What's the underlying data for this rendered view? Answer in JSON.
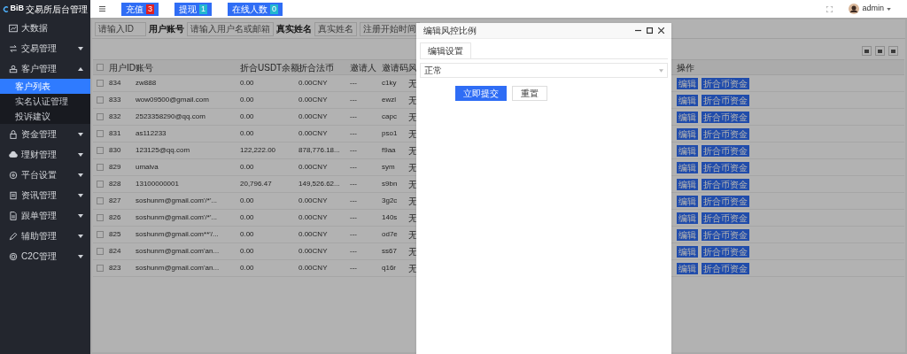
{
  "logo": {
    "text": "BiB",
    "subtitle": "交易所后台管理"
  },
  "sidebar": {
    "items": [
      {
        "label": "大数据"
      },
      {
        "label": "交易管理",
        "expanded": false
      },
      {
        "label": "客户管理",
        "expanded": true,
        "children": [
          {
            "label": "客户列表",
            "selected": true
          },
          {
            "label": "实名认证管理",
            "selected": false
          },
          {
            "label": "投诉建议",
            "selected": false
          }
        ]
      },
      {
        "label": "资金管理",
        "expanded": false
      },
      {
        "label": "理财管理",
        "expanded": false
      },
      {
        "label": "平台设置",
        "expanded": false
      },
      {
        "label": "资讯管理",
        "expanded": false
      },
      {
        "label": "跟单管理",
        "expanded": false
      },
      {
        "label": "辅助管理",
        "expanded": false
      },
      {
        "label": "C2C管理",
        "expanded": false
      }
    ]
  },
  "top_bar": {
    "badges": [
      {
        "label": "充值",
        "count": "3",
        "color": "#e02020"
      },
      {
        "label": "提现",
        "count": "1",
        "color": "#22b8cf"
      },
      {
        "label": "在线人数",
        "count": "0",
        "color": "#22b8cf"
      }
    ],
    "user": "admin"
  },
  "filters": [
    {
      "placeholder": "请输入ID"
    },
    {
      "label": "用户账号",
      "placeholder": "请输入用户名或邮箱"
    },
    {
      "label": "真实姓名",
      "placeholder": "真实姓名"
    },
    {
      "placeholder": "注册开始时间"
    }
  ],
  "table": {
    "all_checked": false,
    "columns": [
      "用户ID",
      "账号",
      "折合USDT余额",
      "折合法币",
      "邀请人",
      "邀请码",
      "风",
      "操作"
    ],
    "rows": [
      {
        "checked": false,
        "cells": [
          "834",
          "zw888",
          "0.00",
          "0.00CNY",
          "---",
          "c1ky",
          "无"
        ],
        "actions": [
          "编辑",
          "折合币资金"
        ]
      },
      {
        "checked": false,
        "cells": [
          "833",
          "wow09500@gmail.com",
          "0.00",
          "0.00CNY",
          "---",
          "ewzl",
          "无"
        ],
        "actions": [
          "编辑",
          "折合币资金"
        ]
      },
      {
        "checked": false,
        "cells": [
          "832",
          "2523358290@qq.com",
          "0.00",
          "0.00CNY",
          "---",
          "capc",
          "无"
        ],
        "actions": [
          "编辑",
          "折合币资金"
        ]
      },
      {
        "checked": false,
        "cells": [
          "831",
          "as112233",
          "0.00",
          "0.00CNY",
          "---",
          "pso1",
          "无"
        ],
        "actions": [
          "编辑",
          "折合币资金"
        ]
      },
      {
        "checked": false,
        "cells": [
          "830",
          "123125@qq.com",
          "122,222.00",
          "878,776.18...",
          "---",
          "f9aa",
          "无"
        ],
        "actions": [
          "编辑",
          "折合币资金"
        ]
      },
      {
        "checked": false,
        "cells": [
          "829",
          "umaiva",
          "0.00",
          "0.00CNY",
          "---",
          "sym",
          "无"
        ],
        "actions": [
          "编辑",
          "折合币资金"
        ]
      },
      {
        "checked": false,
        "cells": [
          "828",
          "13100000001",
          "20,796.47",
          "149,526.62...",
          "---",
          "s9bn",
          "无"
        ],
        "actions": [
          "编辑",
          "折合币资金"
        ]
      },
      {
        "checked": false,
        "cells": [
          "827",
          "soshunm@gmail.com'/*'...",
          "0.00",
          "0.00CNY",
          "---",
          "3g2c",
          "无"
        ],
        "actions": [
          "编辑",
          "折合币资金"
        ]
      },
      {
        "checked": false,
        "cells": [
          "826",
          "soshunm@gmail.com'/*'...",
          "0.00",
          "0.00CNY",
          "---",
          "140s",
          "无"
        ],
        "actions": [
          "编辑",
          "折合币资金"
        ]
      },
      {
        "checked": false,
        "cells": [
          "825",
          "soshunm@gmail.com**'/...",
          "0.00",
          "0.00CNY",
          "---",
          "od7e",
          "无"
        ],
        "actions": [
          "编辑",
          "折合币资金"
        ]
      },
      {
        "checked": false,
        "cells": [
          "824",
          "soshunm@gmail.com'an...",
          "0.00",
          "0.00CNY",
          "---",
          "ss67",
          "无"
        ],
        "actions": [
          "编辑",
          "折合币资金"
        ]
      },
      {
        "checked": false,
        "cells": [
          "823",
          "soshunm@gmail.com'an...",
          "0.00",
          "0.00CNY",
          "---",
          "q16r",
          "无"
        ],
        "actions": [
          "编辑",
          "折合币资金"
        ]
      }
    ]
  },
  "modal": {
    "title": "编辑风控比例",
    "tab": "编辑设置",
    "select_value": "正常",
    "buttons": [
      "立即提交",
      "重置"
    ]
  }
}
